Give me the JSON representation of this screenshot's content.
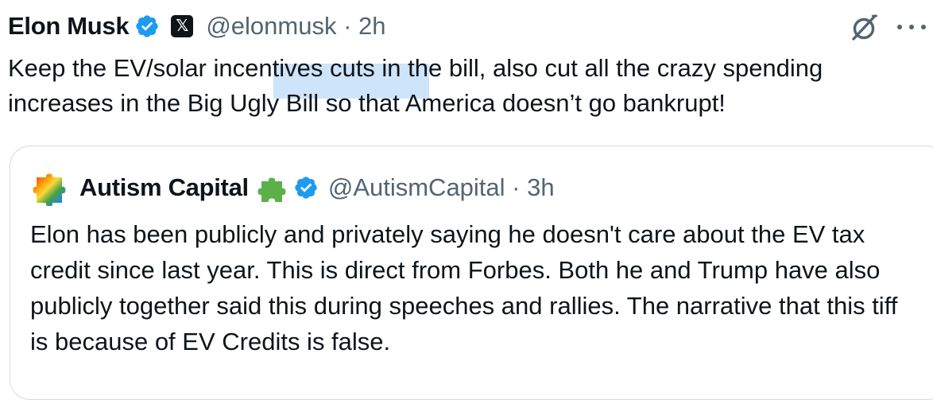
{
  "tweet": {
    "author_name": "Elon Musk",
    "handle_time": "@elonmusk · 2h",
    "x_badge": "𝕏",
    "text": "Keep the EV/solar incentives cuts in the bill, also cut all the crazy spending increases in the Big Ugly Bill so that America doesn’t go bankrupt!"
  },
  "quoted_tweet": {
    "author_name": "Autism Capital",
    "handle_time": "@AutismCapital · 3h",
    "text": "Elon has been publicly and privately saying he doesn't care about the EV tax credit since last year. This is direct from Forbes. Both he and Trump have also publicly together said this during speeches and rallies. The narrative that this tiff is because of EV Credits is false."
  },
  "colors": {
    "text": "#0f1419",
    "secondary": "#536471",
    "verified_blue": "#1d9bf0",
    "puzzle_green": "#5bb04a",
    "border": "#d4dbe1",
    "selection": "#a6cdf5"
  }
}
